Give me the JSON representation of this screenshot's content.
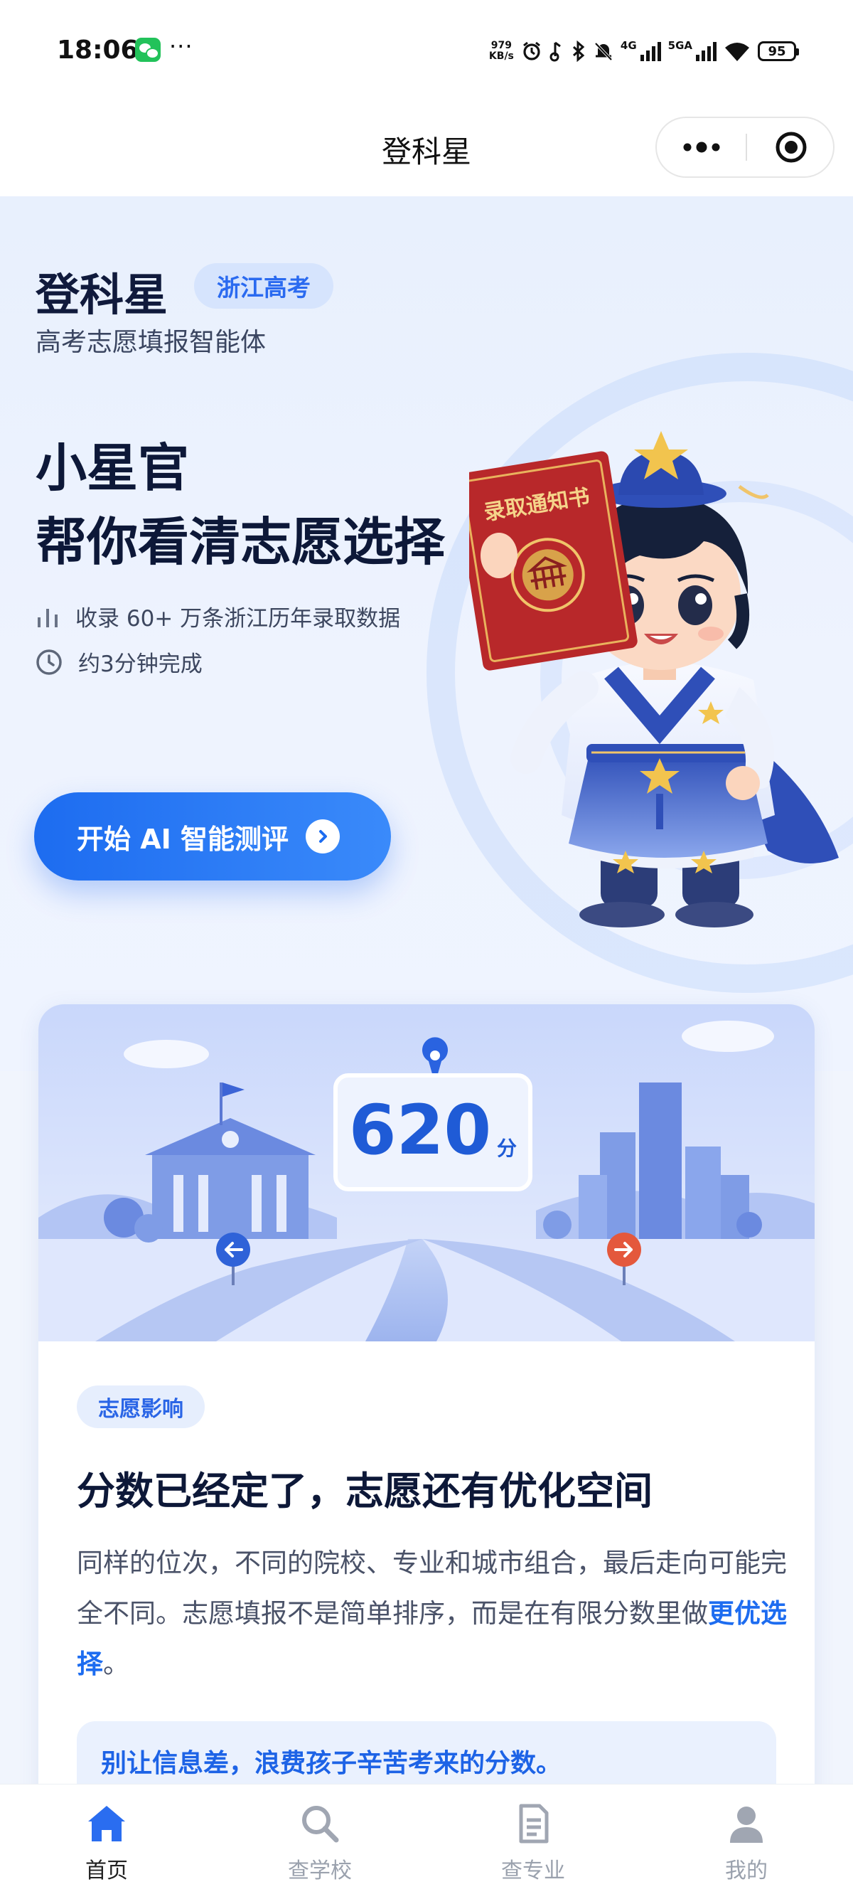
{
  "status_bar": {
    "time": "18:06",
    "dots": "···",
    "speed_value": "979",
    "speed_unit": "KB/s",
    "network_4g": "4G",
    "network_5g": "5GA",
    "battery": "95",
    "icons": [
      "wechat-icon",
      "alarm-icon",
      "headphone-icon",
      "bluetooth-icon",
      "mute-bell-icon",
      "signal-icon",
      "signal-icon",
      "wifi-icon",
      "battery-icon"
    ]
  },
  "nav": {
    "title": "登科星",
    "capsule_icons": [
      "more-icon",
      "close-target-icon"
    ]
  },
  "hero": {
    "brand_title": "登科星",
    "brand_badge": "浙江高考",
    "brand_subtitle": "高考志愿填报智能体",
    "headline_line1": "小星官",
    "headline_line2": "帮你看清志愿选择",
    "feature_1": "收录 60+ 万条浙江历年录取数据",
    "feature_2": "约3分钟完成",
    "cta_label": "开始 AI 智能测评",
    "mascot_book_text": "录取通知书",
    "colors": {
      "primary": "#1d6cf0",
      "hero_bg": "#e8f0fd",
      "title": "#0d1838"
    }
  },
  "card": {
    "score_value": "620",
    "score_unit": "分",
    "tag": "志愿影响",
    "title": "分数已经定了，志愿还有优化空间",
    "body_part1": "同样的位次，不同的院校、专业和城市组合，最后走向可能完全不同。志愿填报不是简单排序，而是在有限分数里做",
    "body_highlight": "更优选择",
    "body_end": "。",
    "note": "别让信息差，浪费孩子辛苦考来的分数。"
  },
  "tabbar": {
    "tabs": [
      {
        "label": "首页",
        "icon": "home-icon",
        "active": true
      },
      {
        "label": "查学校",
        "icon": "search-icon",
        "active": false
      },
      {
        "label": "查专业",
        "icon": "document-icon",
        "active": false
      },
      {
        "label": "我的",
        "icon": "user-icon",
        "active": false
      }
    ]
  }
}
